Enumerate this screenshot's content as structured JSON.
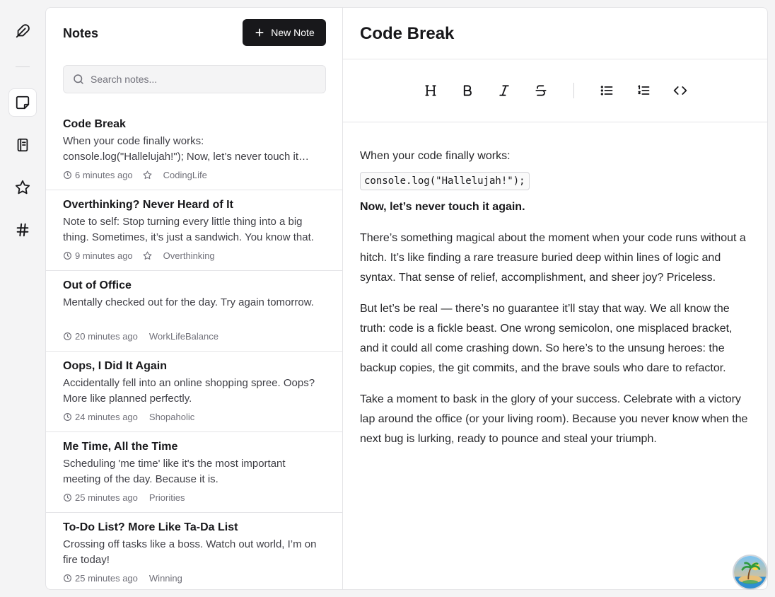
{
  "rail": {
    "items": [
      {
        "icon": "feather-icon"
      },
      {
        "icon": "sticky-note-icon",
        "active": true
      },
      {
        "icon": "notebook-icon"
      },
      {
        "icon": "star-icon"
      },
      {
        "icon": "hash-icon"
      }
    ]
  },
  "list": {
    "title": "Notes",
    "new_note_label": "New Note",
    "search_placeholder": "Search notes..."
  },
  "notes": [
    {
      "title": "Code Break",
      "body": "When your code finally works: console.log(\"Hallelujah!\"); Now, let’s never touch it again.",
      "time": "6 minutes ago",
      "starred": false,
      "show_star": true,
      "tag": "CodingLife"
    },
    {
      "title": "Overthinking? Never Heard of It",
      "body": "Note to self: Stop turning every little thing into a big thing. Sometimes, it’s just a sandwich. You know that.",
      "time": "9 minutes ago",
      "starred": false,
      "show_star": true,
      "tag": "Overthinking"
    },
    {
      "title": "Out of Office",
      "body": "Mentally checked out for the day. Try again tomorrow.",
      "time": "20 minutes ago",
      "show_star": false,
      "tag": "WorkLifeBalance"
    },
    {
      "title": "Oops, I Did It Again",
      "body": "Accidentally fell into an online shopping spree. Oops? More like planned perfectly.",
      "time": "24 minutes ago",
      "show_star": false,
      "tag": "Shopaholic"
    },
    {
      "title": "Me Time, All the Time",
      "body": "Scheduling 'me time' like it's the most important meeting of the day. Because it is.",
      "time": "25 minutes ago",
      "show_star": false,
      "tag": "Priorities"
    },
    {
      "title": "To-Do List? More Like Ta-Da List",
      "body": "Crossing off tasks like a boss. Watch out world, I’m on fire today!",
      "time": "25 minutes ago",
      "show_star": false,
      "tag": "Winning"
    }
  ],
  "editor": {
    "title": "Code Break",
    "toolbar": [
      "heading-icon",
      "bold-icon",
      "italic-icon",
      "strikethrough-icon",
      "bullet-list-icon",
      "ordered-list-icon",
      "code-icon"
    ],
    "intro": "When your code finally works:",
    "code": "console.log(\"Hallelujah!\");",
    "bold_line": "Now, let’s never touch it again.",
    "paragraphs": [
      "There’s something magical about the moment when your code runs without a hitch. It’s like finding a rare treasure buried deep within lines of logic and syntax. That sense of relief, accomplishment, and sheer joy? Priceless.",
      "But let’s be real — there’s no guarantee it’ll stay that way. We all know the truth: code is a fickle beast. One wrong semicolon, one misplaced bracket, and it could all come crashing down. So here’s to the unsung heroes: the backup copies, the git commits, and the brave souls who dare to refactor.",
      "Take a moment to bask in the glory of your success. Celebrate with a victory lap around the office (or your living room). Because you never know when the next bug is lurking, ready to pounce and steal your triumph."
    ]
  },
  "colors": {
    "accent": "#18181b",
    "muted": "#71717a",
    "border": "#e4e4e7",
    "background": "#f4f4f5"
  }
}
